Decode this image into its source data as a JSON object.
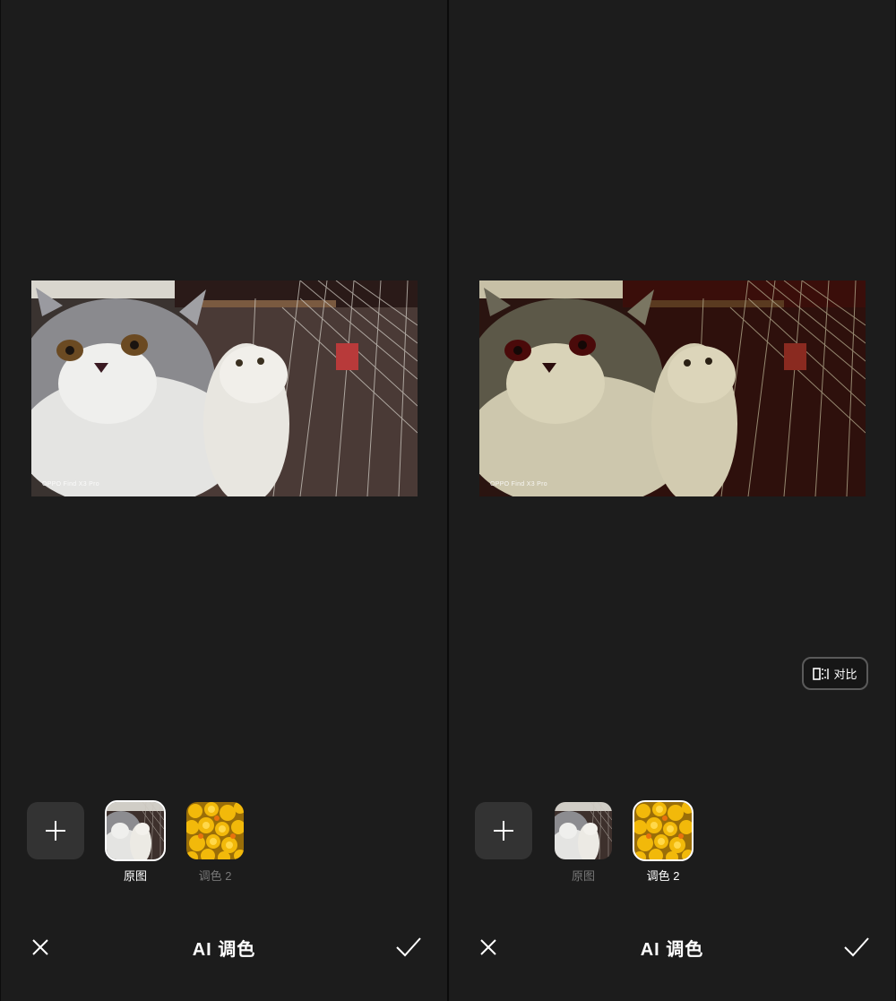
{
  "watermark": "OPPO Find X3 Pro",
  "compare_label": "对比",
  "filters": {
    "original_label": "原图",
    "color2_label": "调色 2"
  },
  "title": "AI 调色",
  "left_screen": {
    "selected_filter": "原图"
  },
  "right_screen": {
    "selected_filter": "调色 2"
  },
  "colors": {
    "background": "#1c1c1c",
    "tile": "#333333",
    "inactive_label": "#777777"
  },
  "icons": [
    "plus-icon",
    "close-icon",
    "check-icon",
    "compare-icon"
  ]
}
